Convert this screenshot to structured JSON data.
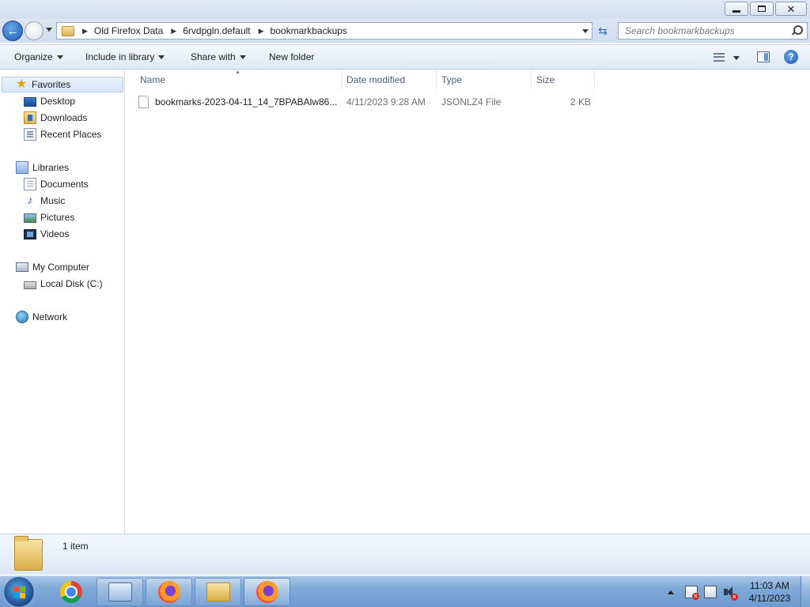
{
  "window": {
    "minimize_icon": "minimize-icon",
    "restore_icon": "restore-icon",
    "close_icon": "close-icon"
  },
  "address": {
    "crumbs": [
      "Old Firefox Data",
      "6rvdpgln.default",
      "bookmarkbackups"
    ],
    "search_placeholder": "Search bookmarkbackups"
  },
  "toolbar": {
    "organize": "Organize",
    "include_in_library": "Include in library",
    "share_with": "Share with",
    "new_folder": "New folder"
  },
  "sidebar": {
    "favorites": {
      "label": "Favorites",
      "items": [
        "Desktop",
        "Downloads",
        "Recent Places"
      ]
    },
    "libraries": {
      "label": "Libraries",
      "items": [
        "Documents",
        "Music",
        "Pictures",
        "Videos"
      ]
    },
    "computer": {
      "label": "My Computer",
      "items": [
        "Local Disk (C:)"
      ]
    },
    "network": {
      "label": "Network"
    }
  },
  "columns": {
    "name": "Name",
    "date_modified": "Date modified",
    "type": "Type",
    "size": "Size"
  },
  "files": [
    {
      "name": "bookmarks-2023-04-11_14_7BPABAlw86...",
      "date_modified": "4/11/2023 9:28 AM",
      "type": "JSONLZ4 File",
      "size": "2 KB"
    }
  ],
  "details": {
    "item_count": "1 item"
  },
  "taskbar": {
    "apps": [
      "start-orb",
      "chrome",
      "control-panel",
      "firefox",
      "windows-explorer",
      "firefox"
    ],
    "clock_time": "11:03 AM",
    "clock_date": "4/11/2023"
  },
  "colors": {
    "taskbar": "#7ea8d6",
    "selection": "#d5e7fb",
    "accent": "#1d58b4"
  }
}
